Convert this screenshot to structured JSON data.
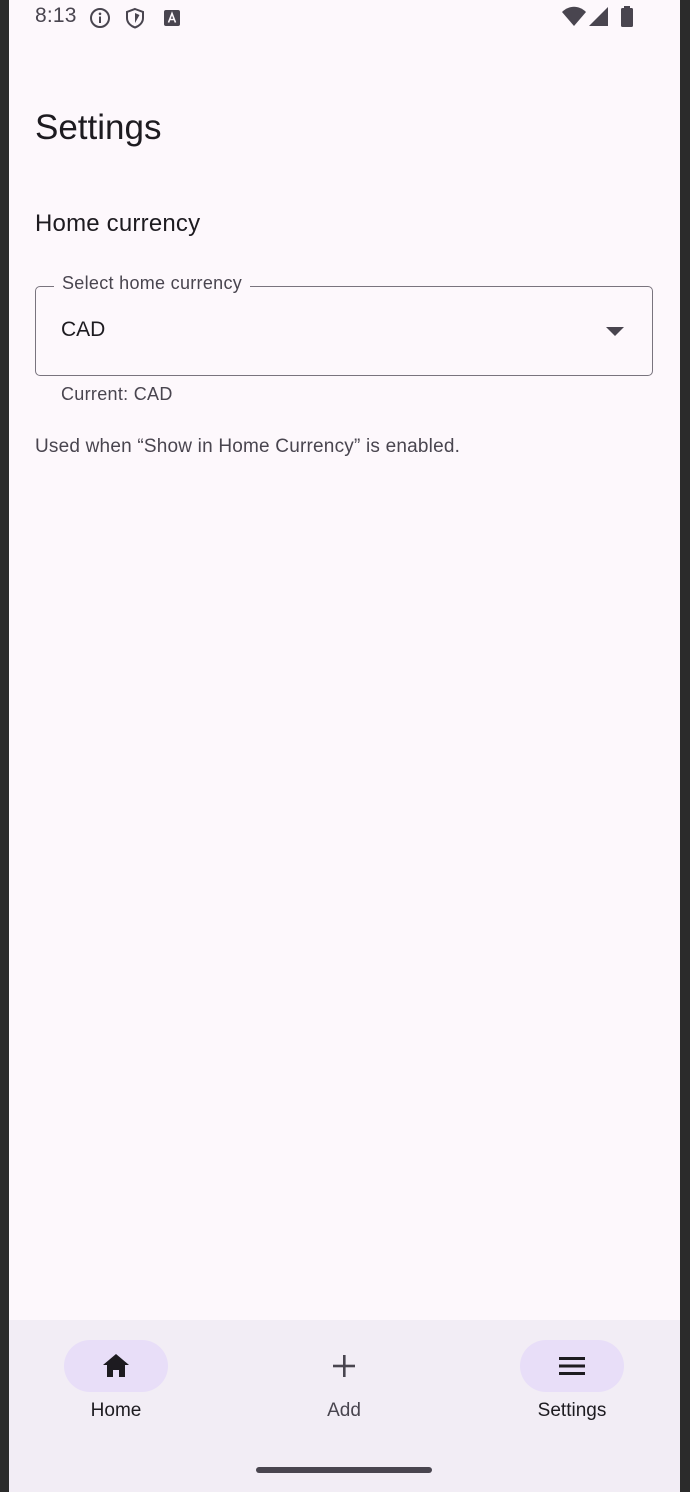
{
  "status_bar": {
    "time": "8:13",
    "icons_left": [
      "info-icon",
      "shield-icon",
      "keyboard-a-icon"
    ],
    "icons_right": [
      "wifi-icon",
      "cell-signal-icon",
      "battery-icon"
    ]
  },
  "page": {
    "title": "Settings"
  },
  "home_currency": {
    "section_title": "Home currency",
    "select_label": "Select home currency",
    "selected_value": "CAD",
    "current_text": "Current: CAD",
    "help_text": "Used when “Show in Home Currency” is enabled."
  },
  "bottom_nav": {
    "items": [
      {
        "label": "Home",
        "icon": "home-icon",
        "active": true
      },
      {
        "label": "Add",
        "icon": "plus-icon",
        "active": false
      },
      {
        "label": "Settings",
        "icon": "menu-icon",
        "active": true
      }
    ]
  },
  "colors": {
    "background": "#fdf8fc",
    "nav_background": "#f2edf5",
    "active_pill": "#e8def8",
    "text_primary": "#1d1b20",
    "text_secondary": "#49454f",
    "outline": "#79747e"
  }
}
